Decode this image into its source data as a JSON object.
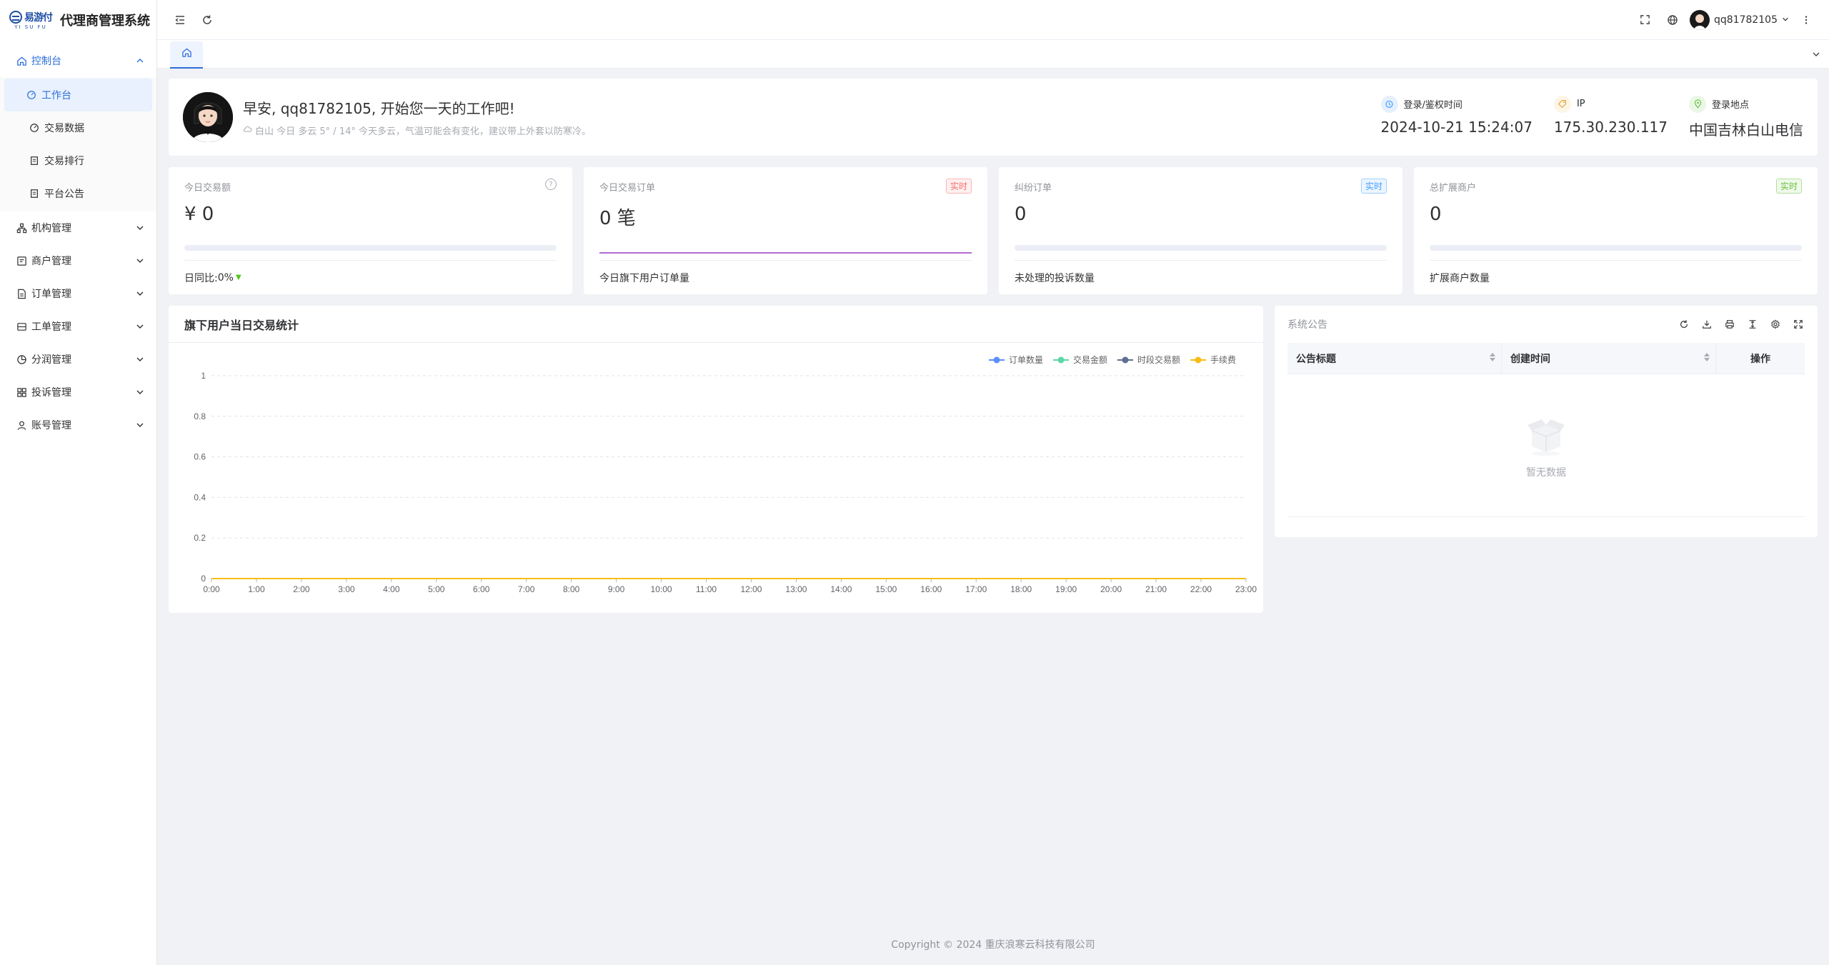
{
  "app": {
    "logo_cn": "易游付",
    "logo_en": "YI SU FU",
    "title": "代理商管理系统"
  },
  "sidebar": {
    "items": [
      {
        "label": "控制台",
        "icon": "home-icon",
        "open": true,
        "children": [
          {
            "label": "工作台",
            "icon": "dashboard-icon",
            "active": true
          },
          {
            "label": "交易数据",
            "icon": "gauge-icon"
          },
          {
            "label": "交易排行",
            "icon": "document-icon"
          },
          {
            "label": "平台公告",
            "icon": "document-icon"
          }
        ]
      },
      {
        "label": "机构管理",
        "icon": "org-icon"
      },
      {
        "label": "商户管理",
        "icon": "merchant-icon"
      },
      {
        "label": "订单管理",
        "icon": "order-icon"
      },
      {
        "label": "工单管理",
        "icon": "ticket-icon"
      },
      {
        "label": "分润管理",
        "icon": "pie-icon"
      },
      {
        "label": "投诉管理",
        "icon": "grid-icon"
      },
      {
        "label": "账号管理",
        "icon": "user-icon"
      }
    ]
  },
  "header": {
    "username": "qq81782105"
  },
  "welcome": {
    "greeting": "早安, qq81782105, 开始您一天的工作吧!",
    "weather": "白山 今日 多云 5° / 14° 今天多云，气温可能会有变化，建议带上外套以防寒冷。",
    "login_time_label": "登录/鉴权时间",
    "login_time": "2024-10-21 15:24:07",
    "ip_label": "IP",
    "ip": "175.30.230.117",
    "location_label": "登录地点",
    "location": "中国吉林白山电信"
  },
  "stats": [
    {
      "label": "今日交易额",
      "value": "¥ 0",
      "footer_label": "日同比: ",
      "footer_value": "0%",
      "progress": 0
    },
    {
      "label": "今日交易订单",
      "value": "0 笔",
      "tag": "实时",
      "footer_label": "今日旗下用户订单量"
    },
    {
      "label": "纠纷订单",
      "value": "0",
      "tag": "实时",
      "footer_label": "未处理的投诉数量",
      "progress": 0
    },
    {
      "label": "总扩展商户",
      "value": "0",
      "tag": "实时",
      "footer_label": "扩展商户数量",
      "progress": 0
    }
  ],
  "colors": {
    "accent": "#2d6fd8",
    "tag_red": "#f56c6c",
    "tag_blue": "#409eff",
    "tag_green": "#67c23a",
    "order_line": "#b36bd4"
  },
  "chart_title": "旗下用户当日交易统计",
  "chart_data": {
    "type": "line",
    "categories": [
      "0:00",
      "1:00",
      "2:00",
      "3:00",
      "4:00",
      "5:00",
      "6:00",
      "7:00",
      "8:00",
      "9:00",
      "10:00",
      "11:00",
      "12:00",
      "13:00",
      "14:00",
      "15:00",
      "16:00",
      "17:00",
      "18:00",
      "19:00",
      "20:00",
      "21:00",
      "22:00",
      "23:00"
    ],
    "series": [
      {
        "name": "订单数量",
        "color": "#5b8ff9",
        "values": [
          0,
          0,
          0,
          0,
          0,
          0,
          0,
          0,
          0,
          0,
          0,
          0,
          0,
          0,
          0,
          0,
          0,
          0,
          0,
          0,
          0,
          0,
          0,
          0
        ]
      },
      {
        "name": "交易金额",
        "color": "#5ad8a6",
        "values": [
          0,
          0,
          0,
          0,
          0,
          0,
          0,
          0,
          0,
          0,
          0,
          0,
          0,
          0,
          0,
          0,
          0,
          0,
          0,
          0,
          0,
          0,
          0,
          0
        ]
      },
      {
        "name": "时段交易额",
        "color": "#5d7092",
        "values": [
          0,
          0,
          0,
          0,
          0,
          0,
          0,
          0,
          0,
          0,
          0,
          0,
          0,
          0,
          0,
          0,
          0,
          0,
          0,
          0,
          0,
          0,
          0,
          0
        ]
      },
      {
        "name": "手续费",
        "color": "#f6bd16",
        "values": [
          0,
          0,
          0,
          0,
          0,
          0,
          0,
          0,
          0,
          0,
          0,
          0,
          0,
          0,
          0,
          0,
          0,
          0,
          0,
          0,
          0,
          0,
          0,
          0
        ]
      }
    ],
    "yticks": [
      "0",
      "0.2",
      "0.4",
      "0.6",
      "0.8",
      "1"
    ],
    "ylim": [
      0,
      1
    ],
    "grid": true,
    "legend_position": "top-right"
  },
  "notice": {
    "title": "系统公告",
    "columns": [
      "公告标题",
      "创建时间",
      "操作"
    ],
    "empty_text": "暂无数据"
  },
  "footer": {
    "copyright": "Copyright © 2024 重庆浪寒云科技有限公司"
  }
}
